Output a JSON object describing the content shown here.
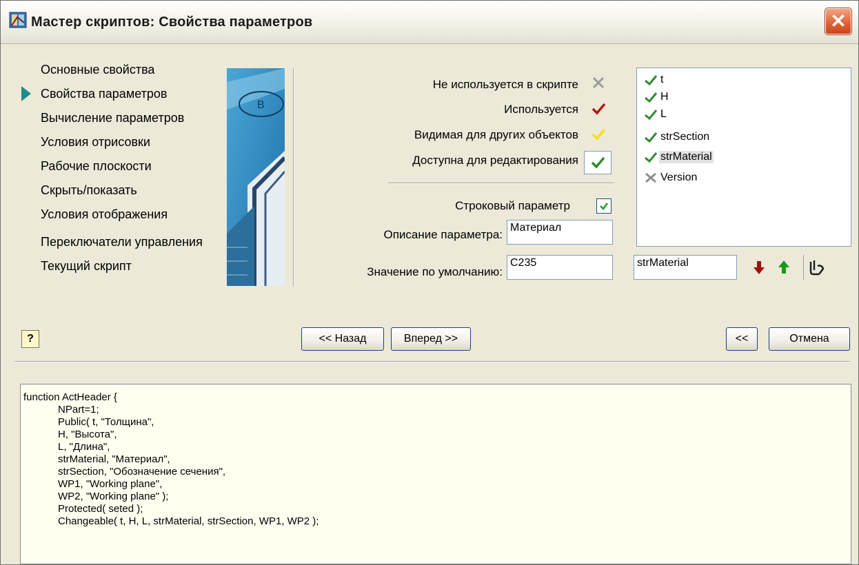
{
  "window": {
    "title": "Мастер скриптов:  Свойства параметров",
    "close_label": "✕"
  },
  "nav": {
    "items": [
      {
        "label": "Основные свойства"
      },
      {
        "label": "Свойства параметров"
      },
      {
        "label": "Вычисление параметров"
      },
      {
        "label": "Условия отрисовки"
      },
      {
        "label": "Рабочие плоскости"
      },
      {
        "label": "Скрыть/показать"
      },
      {
        "label": "Условия отображения"
      },
      {
        "label": "Переключатели управления"
      },
      {
        "label": "Текущий скрипт"
      }
    ],
    "active_index": 1
  },
  "usage": {
    "not_used": "Не используется в скрипте",
    "used": "Используется",
    "visible": "Видимая для других объектов",
    "editable": "Доступна для редактирования",
    "colors": {
      "not_used": "#9a9a9a",
      "used": "#b01818",
      "visible": "#f0e020",
      "editable": "#2e8b2e"
    }
  },
  "string_param": {
    "label": "Строковый параметр",
    "checked": true
  },
  "description": {
    "label": "Описание параметра:",
    "value": "Материал"
  },
  "default_value": {
    "label": "Значение по умолчанию:",
    "value": "С235"
  },
  "params": {
    "items": [
      {
        "name": "t",
        "icon": "check-icon"
      },
      {
        "name": "H",
        "icon": "check-icon"
      },
      {
        "name": "L",
        "icon": "check-icon"
      },
      {
        "name": "strSection",
        "icon": "check-icon"
      },
      {
        "name": "strMaterial",
        "icon": "check-icon",
        "selected": true
      },
      {
        "name": "Version",
        "icon": "cross-icon"
      }
    ],
    "current_name": "strMaterial"
  },
  "buttons": {
    "back": "<< Назад",
    "next": "Вперед >>",
    "collapse": "<<",
    "cancel": "Отмена",
    "help": "?"
  },
  "code": {
    "lines": [
      "function ActHeader {",
      "            NPart=1;",
      "            Public( t, \"Толщина\",",
      "            H, \"Высота\",",
      "            L, \"Длина\",",
      "            strMaterial, \"Материал\",",
      "            strSection, \"Обозначение сечения\",",
      "            WP1, \"Working plane\",",
      "            WP2, \"Working plane\" );",
      "            Protected( seted );",
      "            Changeable( t, H, L, strMaterial, strSection, WP1, WP2 );"
    ]
  }
}
